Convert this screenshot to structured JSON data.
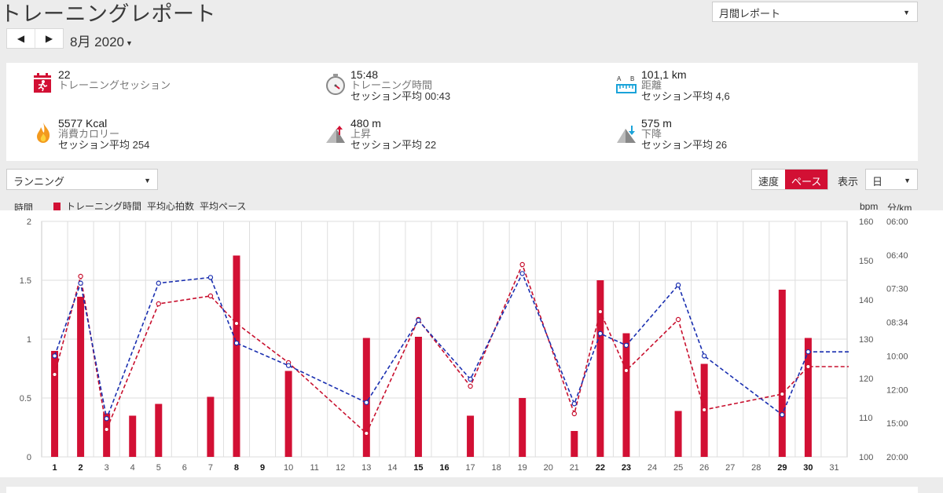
{
  "header": {
    "title": "トレーニングレポート",
    "report_type": "月間レポート",
    "month": "8月 2020"
  },
  "summary": {
    "sessions": {
      "value": "22",
      "label": "トレーニングセッション"
    },
    "time": {
      "value": "15:48",
      "label": "トレーニング時間",
      "avg": "セッション平均 00:43"
    },
    "distance": {
      "value": "101,1 km",
      "label": "距離",
      "avg": "セッション平均 4,6",
      "icon_text_a": "A",
      "icon_text_b": "B"
    },
    "calories": {
      "value": "5577 Kcal",
      "label": "消費カロリー",
      "avg": "セッション平均 254"
    },
    "ascent": {
      "value": "480 m",
      "label": "上昇",
      "avg": "セッション平均 22"
    },
    "descent": {
      "value": "575 m",
      "label": "下降",
      "avg": "セッション平均 26"
    }
  },
  "controls": {
    "sport": "ランニング",
    "speed": "速度",
    "pace": "ペース",
    "display_label": "表示",
    "period": "日"
  },
  "legend": {
    "left_axis": "時間",
    "training_time": "トレーニング時間",
    "avg_hr": "平均心拍数",
    "avg_pace": "平均ペース",
    "bpm_axis": "bpm",
    "pace_axis": "分/km"
  },
  "colors": {
    "accent": "#d21034",
    "hr_line": "#c8102e",
    "pace_line": "#1a2fb0"
  },
  "chart_data": {
    "type": "bar",
    "days": [
      "1",
      "2",
      "3",
      "4",
      "5",
      "6",
      "7",
      "8",
      "9",
      "10",
      "11",
      "12",
      "13",
      "14",
      "15",
      "16",
      "17",
      "18",
      "19",
      "20",
      "21",
      "22",
      "23",
      "24",
      "25",
      "26",
      "27",
      "28",
      "29",
      "30",
      "31"
    ],
    "bold_days": [
      "1",
      "2",
      "8",
      "9",
      "15",
      "16",
      "22",
      "23",
      "29",
      "30"
    ],
    "hours": [
      0.9,
      1.36,
      0.37,
      0.35,
      0.45,
      0,
      0.51,
      1.71,
      0,
      0.73,
      0,
      0,
      1.01,
      0,
      1.02,
      0,
      0.35,
      0,
      0.5,
      0,
      0.22,
      1.5,
      1.05,
      0,
      0.39,
      0.79,
      0,
      0,
      1.42,
      1.01,
      0
    ],
    "hr_points": [
      [
        1,
        121
      ],
      [
        2,
        146
      ],
      [
        3,
        107
      ],
      [
        5,
        139
      ],
      [
        7,
        141
      ],
      [
        8,
        134
      ],
      [
        10,
        124
      ],
      [
        13,
        106
      ],
      [
        15,
        135
      ],
      [
        17,
        118
      ],
      [
        19,
        149
      ],
      [
        21,
        111
      ],
      [
        22,
        137
      ],
      [
        23,
        122
      ],
      [
        25,
        135
      ],
      [
        26,
        112
      ],
      [
        29,
        116
      ],
      [
        30,
        123
      ],
      [
        31,
        123
      ]
    ],
    "pace_points": [
      [
        1,
        10.0
      ],
      [
        2,
        7.35
      ],
      [
        3,
        14.5
      ],
      [
        5,
        7.35
      ],
      [
        7,
        7.2
      ],
      [
        8,
        9.4
      ],
      [
        10,
        10.5
      ],
      [
        13,
        13.0
      ],
      [
        15,
        8.5
      ],
      [
        17,
        11.3
      ],
      [
        19,
        7.1
      ],
      [
        21,
        13.1
      ],
      [
        22,
        9.0
      ],
      [
        23,
        9.5
      ],
      [
        25,
        7.4
      ],
      [
        26,
        10.0
      ],
      [
        29,
        14.1
      ],
      [
        30,
        9.8
      ],
      [
        31,
        9.8
      ]
    ],
    "y_left": {
      "label": "時間",
      "ticks": [
        "0",
        "0.5",
        "1",
        "1.5",
        "2"
      ],
      "range": [
        0,
        2
      ]
    },
    "y_hr": {
      "label": "bpm",
      "ticks": [
        "100",
        "110",
        "120",
        "130",
        "140",
        "150",
        "160"
      ],
      "range": [
        100,
        160
      ]
    },
    "y_pace": {
      "label": "分/km",
      "ticks": [
        "20:00",
        "15:00",
        "12:00",
        "10:00",
        "08:34",
        "07:30",
        "06:40",
        "06:00"
      ],
      "range": [
        20,
        6
      ]
    }
  }
}
